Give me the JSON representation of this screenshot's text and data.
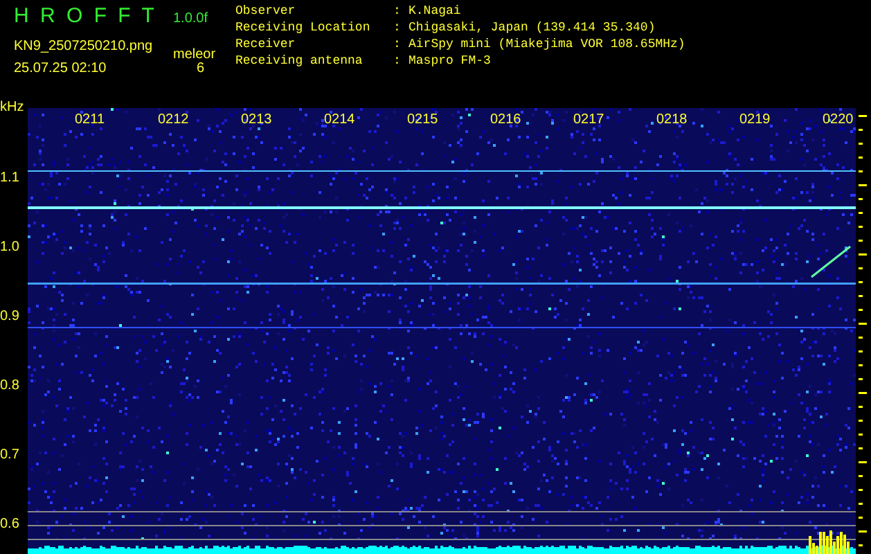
{
  "header": {
    "title": "H R O F F T",
    "version": "1.0.0f",
    "filename": "KN9_2507250210.png",
    "mode_label": "meleor",
    "count": "6",
    "timestamp": "25.07.25 02:10"
  },
  "station_info": [
    {
      "label": "Observer",
      "separator": ":",
      "value": "K.Nagai"
    },
    {
      "label": "Receiving Location",
      "separator": ":",
      "value": "Chigasaki, Japan (139.414 35.340)"
    },
    {
      "label": "Receiver",
      "separator": ":",
      "value": "AirSpy mini (Miakejima VOR 108.65MHz)"
    },
    {
      "label": "Receiving antenna",
      "separator": ":",
      "value": "Maspro FM-3"
    }
  ],
  "spectrogram": {
    "unit": "kHz",
    "time_labels": [
      "0211",
      "0212",
      "0213",
      "0214",
      "0215",
      "0216",
      "0217",
      "0218",
      "0219",
      "0220"
    ],
    "frequency_labels": [
      "1.1",
      "1.0",
      "0.9",
      "0.8",
      "0.7",
      "0.6"
    ]
  }
}
